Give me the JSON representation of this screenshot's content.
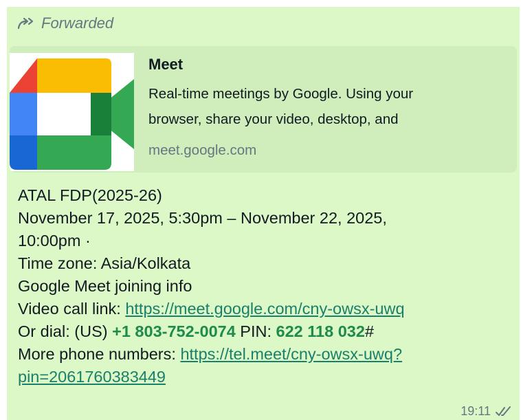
{
  "forwarded_label": "Forwarded",
  "preview": {
    "title": "Meet",
    "description_line1": "Real-time meetings by Google. Using your",
    "description_line2": "browser, share your video, desktop, and",
    "domain": "meet.google.com",
    "logo": "google-meet-logo"
  },
  "message": {
    "line1": "ATAL FDP(2025-26)",
    "line2": "November 17, 2025, 5:30pm – November 22, 2025,",
    "line3": "10:00pm ·",
    "line4": "Time zone: Asia/Kolkata",
    "line5": "Google Meet joining info",
    "video_label": "Video call link: ",
    "video_link": "https://meet.google.com/cny-owsx-uwq",
    "dial_label": "Or dial: (US) ",
    "dial_number": "+1 803-752-0074",
    "pin_label": " PIN: ",
    "pin_value": "622 118 032",
    "pin_suffix": "#",
    "more_label": "More phone numbers: ",
    "more_link_part1": "https://tel.meet/cny-owsx-uwq?",
    "more_link_part2": "pin=2061760383449"
  },
  "meta": {
    "time": "19:11",
    "status_icon": "double-check-icon"
  },
  "colors": {
    "bubble": "#dcf8c6",
    "preview_bg": "#cfeebc",
    "link": "#1a7f6b",
    "highlight": "#1f8a4c"
  }
}
